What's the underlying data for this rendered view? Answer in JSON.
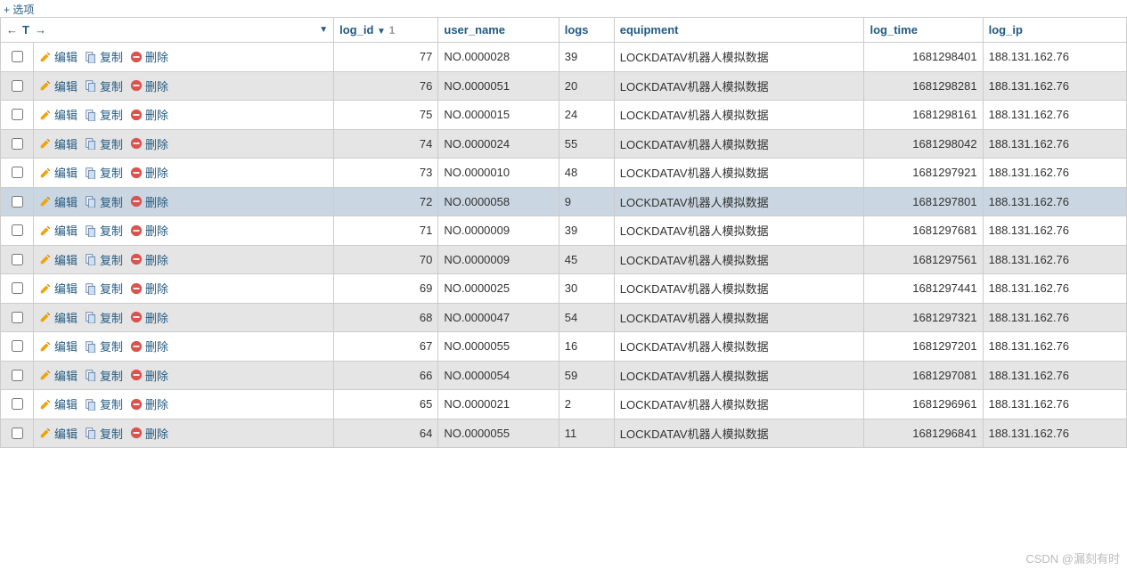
{
  "options_label": "+ 选项",
  "sort_controls": {
    "left": "←",
    "t": "T",
    "right": "→",
    "desc": "▼",
    "num": "1"
  },
  "action_labels": {
    "edit": "编辑",
    "copy": "复制",
    "delete": "删除"
  },
  "columns": [
    "log_id",
    "user_name",
    "logs",
    "equipment",
    "log_time",
    "log_ip"
  ],
  "rows": [
    {
      "log_id": "77",
      "user_name": "NO.0000028",
      "logs": "39",
      "equipment": "LOCKDATAV机器人模拟数据",
      "log_time": "1681298401",
      "log_ip": "188.131.162.76"
    },
    {
      "log_id": "76",
      "user_name": "NO.0000051",
      "logs": "20",
      "equipment": "LOCKDATAV机器人模拟数据",
      "log_time": "1681298281",
      "log_ip": "188.131.162.76"
    },
    {
      "log_id": "75",
      "user_name": "NO.0000015",
      "logs": "24",
      "equipment": "LOCKDATAV机器人模拟数据",
      "log_time": "1681298161",
      "log_ip": "188.131.162.76"
    },
    {
      "log_id": "74",
      "user_name": "NO.0000024",
      "logs": "55",
      "equipment": "LOCKDATAV机器人模拟数据",
      "log_time": "1681298042",
      "log_ip": "188.131.162.76"
    },
    {
      "log_id": "73",
      "user_name": "NO.0000010",
      "logs": "48",
      "equipment": "LOCKDATAV机器人模拟数据",
      "log_time": "1681297921",
      "log_ip": "188.131.162.76"
    },
    {
      "log_id": "72",
      "user_name": "NO.0000058",
      "logs": "9",
      "equipment": "LOCKDATAV机器人模拟数据",
      "log_time": "1681297801",
      "log_ip": "188.131.162.76",
      "highlight": true
    },
    {
      "log_id": "71",
      "user_name": "NO.0000009",
      "logs": "39",
      "equipment": "LOCKDATAV机器人模拟数据",
      "log_time": "1681297681",
      "log_ip": "188.131.162.76"
    },
    {
      "log_id": "70",
      "user_name": "NO.0000009",
      "logs": "45",
      "equipment": "LOCKDATAV机器人模拟数据",
      "log_time": "1681297561",
      "log_ip": "188.131.162.76"
    },
    {
      "log_id": "69",
      "user_name": "NO.0000025",
      "logs": "30",
      "equipment": "LOCKDATAV机器人模拟数据",
      "log_time": "1681297441",
      "log_ip": "188.131.162.76"
    },
    {
      "log_id": "68",
      "user_name": "NO.0000047",
      "logs": "54",
      "equipment": "LOCKDATAV机器人模拟数据",
      "log_time": "1681297321",
      "log_ip": "188.131.162.76"
    },
    {
      "log_id": "67",
      "user_name": "NO.0000055",
      "logs": "16",
      "equipment": "LOCKDATAV机器人模拟数据",
      "log_time": "1681297201",
      "log_ip": "188.131.162.76"
    },
    {
      "log_id": "66",
      "user_name": "NO.0000054",
      "logs": "59",
      "equipment": "LOCKDATAV机器人模拟数据",
      "log_time": "1681297081",
      "log_ip": "188.131.162.76"
    },
    {
      "log_id": "65",
      "user_name": "NO.0000021",
      "logs": "2",
      "equipment": "LOCKDATAV机器人模拟数据",
      "log_time": "1681296961",
      "log_ip": "188.131.162.76"
    },
    {
      "log_id": "64",
      "user_name": "NO.0000055",
      "logs": "11",
      "equipment": "LOCKDATAV机器人模拟数据",
      "log_time": "1681296841",
      "log_ip": "188.131.162.76"
    }
  ],
  "watermark": "CSDN @漏刻有时"
}
